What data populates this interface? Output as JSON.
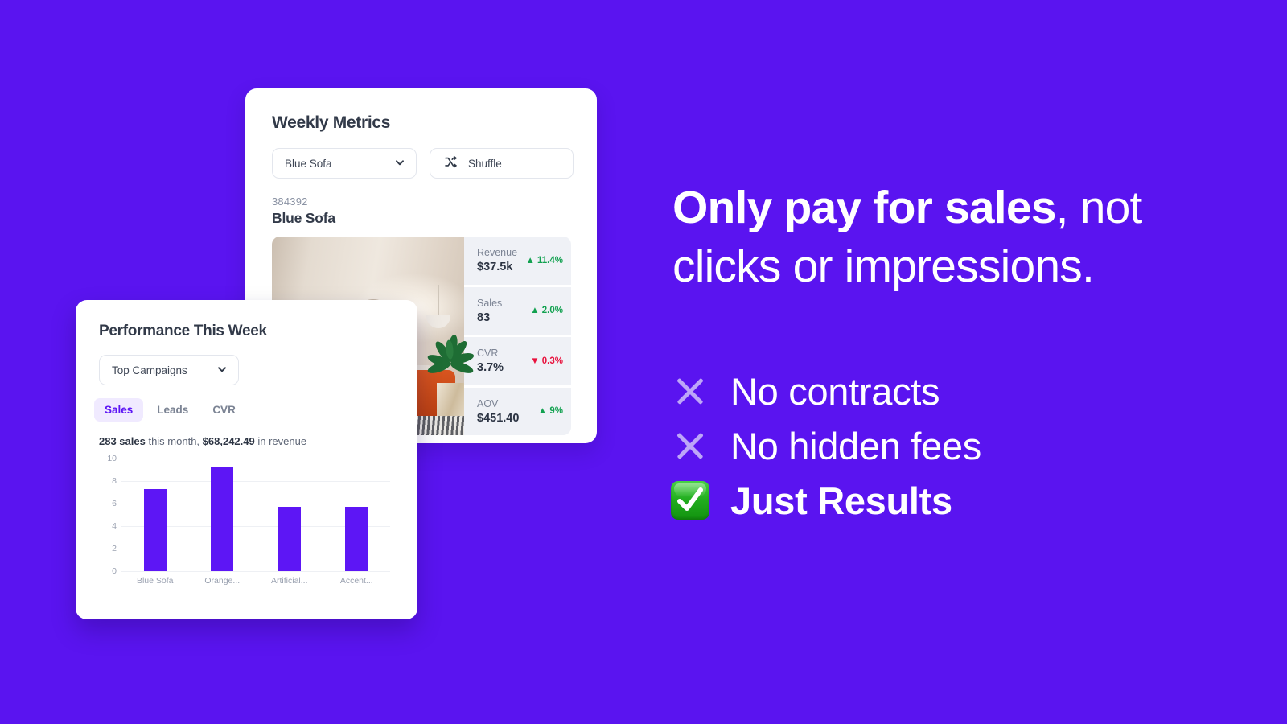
{
  "promo": {
    "headline_bold": "Only pay for sales",
    "headline_rest": ", not clicks or impressions.",
    "bullets": [
      {
        "icon": "cross-mark-icon",
        "label": "No contracts",
        "strong": false
      },
      {
        "icon": "cross-mark-icon",
        "label": "No hidden fees",
        "strong": false
      },
      {
        "icon": "check-mark-button-icon",
        "label": "Just Results",
        "strong": true
      }
    ]
  },
  "weekly_card": {
    "title": "Weekly Metrics",
    "product_select": {
      "value": "Blue Sofa",
      "icon": "chevron-down-icon"
    },
    "shuffle_button": {
      "label": "Shuffle",
      "icon": "shuffle-icon"
    },
    "product_id": "384392",
    "product_name": "Blue Sofa",
    "product_image_alt": "Living room with orange sofa, plant and round mirror",
    "metrics": [
      {
        "label": "Revenue",
        "value": "$37.5k",
        "delta": "11.4%",
        "direction": "up"
      },
      {
        "label": "Sales",
        "value": "83",
        "delta": "2.0%",
        "direction": "up"
      },
      {
        "label": "CVR",
        "value": "3.7%",
        "delta": "0.3%",
        "direction": "down"
      },
      {
        "label": "AOV",
        "value": "$451.40",
        "delta": "9%",
        "direction": "up"
      }
    ]
  },
  "performance_card": {
    "title": "Performance This Week",
    "campaign_select": {
      "value": "Top Campaigns",
      "icon": "chevron-down-icon"
    },
    "tabs": [
      {
        "label": "Sales",
        "active": true
      },
      {
        "label": "Leads",
        "active": false
      },
      {
        "label": "CVR",
        "active": false
      }
    ],
    "summary": {
      "sales_count": "283 sales",
      "mid": " this month, ",
      "revenue": "$68,242.49",
      "tail": " in revenue"
    }
  },
  "chart_data": {
    "type": "bar",
    "title": "",
    "categories": [
      "Blue Sofa",
      "Orange...",
      "Artificial...",
      "Accent..."
    ],
    "values": [
      7.3,
      9.3,
      5.75,
      5.75
    ],
    "xlabel": "",
    "ylabel": "",
    "ylim": [
      0,
      10
    ],
    "yticks": [
      10,
      8,
      6,
      4,
      2,
      0
    ],
    "grid": true,
    "legend": "none",
    "bar_color": "#5d16f5"
  },
  "colors": {
    "background": "#5a14f0",
    "accent": "#5d16f5",
    "positive": "#12a150",
    "negative": "#e8113c",
    "card": "#ffffff",
    "metric_tile": "#eff1f6"
  }
}
